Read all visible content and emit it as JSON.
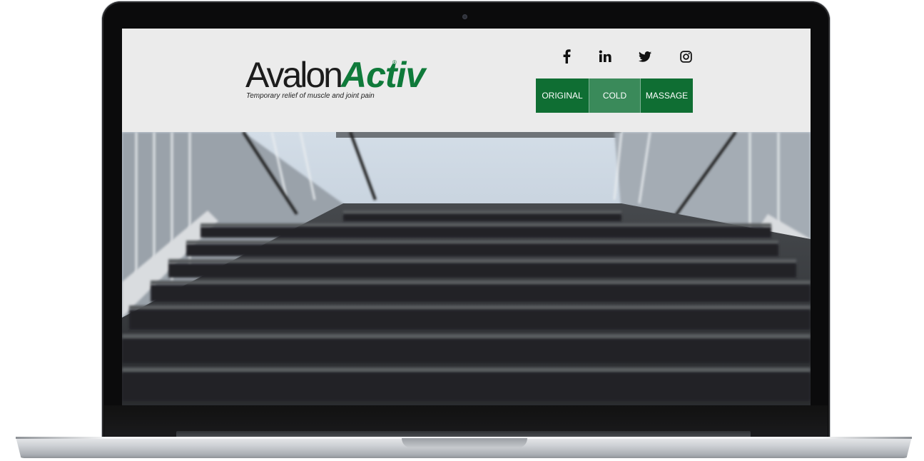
{
  "brand": {
    "name_part1": "Avalon",
    "name_part2": "Activ",
    "registered_mark": "®",
    "tagline": "Temporary relief of muscle and joint pain",
    "accent_color": "#0f7a3a"
  },
  "social": [
    {
      "name": "facebook",
      "glyph": "f"
    },
    {
      "name": "linkedin",
      "glyph": "in"
    },
    {
      "name": "twitter",
      "glyph": "twitter-bird"
    },
    {
      "name": "instagram",
      "glyph": "instagram-camera"
    }
  ],
  "nav": {
    "items": [
      {
        "label": "ORIGINAL",
        "color": "#0f6e33"
      },
      {
        "label": "COLD",
        "color": "#3a8a5a"
      },
      {
        "label": "MASSAGE",
        "color": "#0f6e33"
      }
    ]
  },
  "hero": {
    "image": "blurred outdoor staircase with metal railings"
  }
}
